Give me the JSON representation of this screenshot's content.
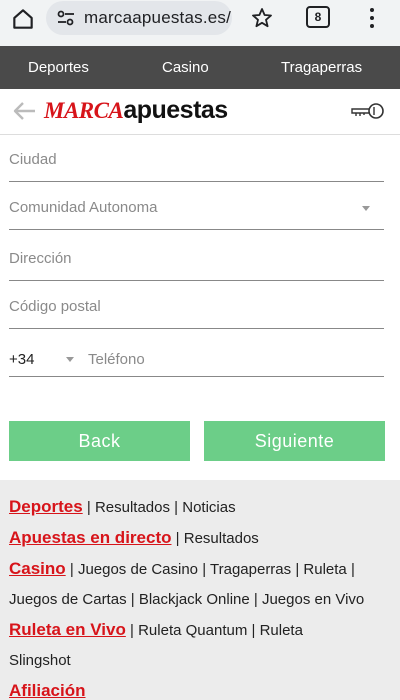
{
  "browser": {
    "url": "marcaapuestas.es/",
    "tab_count": "8"
  },
  "nav": {
    "items": [
      "Deportes",
      "Casino",
      "Tragaperras"
    ]
  },
  "header": {
    "logo_marca": "MARCA",
    "logo_apuestas": "apuestas"
  },
  "form": {
    "ciudad": "Ciudad",
    "comunidad": "Comunidad Autonoma",
    "direccion": "Dirección",
    "codigo_postal": "Código postal",
    "phone_prefix": "+34",
    "telefono": "Teléfono"
  },
  "buttons": {
    "back": "Back",
    "next": "Siguiente"
  },
  "footer": {
    "deportes": "Deportes",
    "deportes_links": [
      "Resultados",
      "Noticias"
    ],
    "apuestas": "Apuestas en directo",
    "apuestas_links": [
      "Resultados"
    ],
    "casino": "Casino",
    "casino_links": [
      "Juegos de Casino",
      "Tragaperras",
      "Ruleta"
    ],
    "casino_links2": [
      "Juegos de Cartas",
      "Blackjack Online",
      "Juegos en Vivo"
    ],
    "ruleta": "Ruleta en Vivo",
    "ruleta_links": [
      "Ruleta Quantum",
      "Ruleta"
    ],
    "ruleta_links2": [
      "Slingshot"
    ],
    "afiliacion": "Afiliación"
  }
}
